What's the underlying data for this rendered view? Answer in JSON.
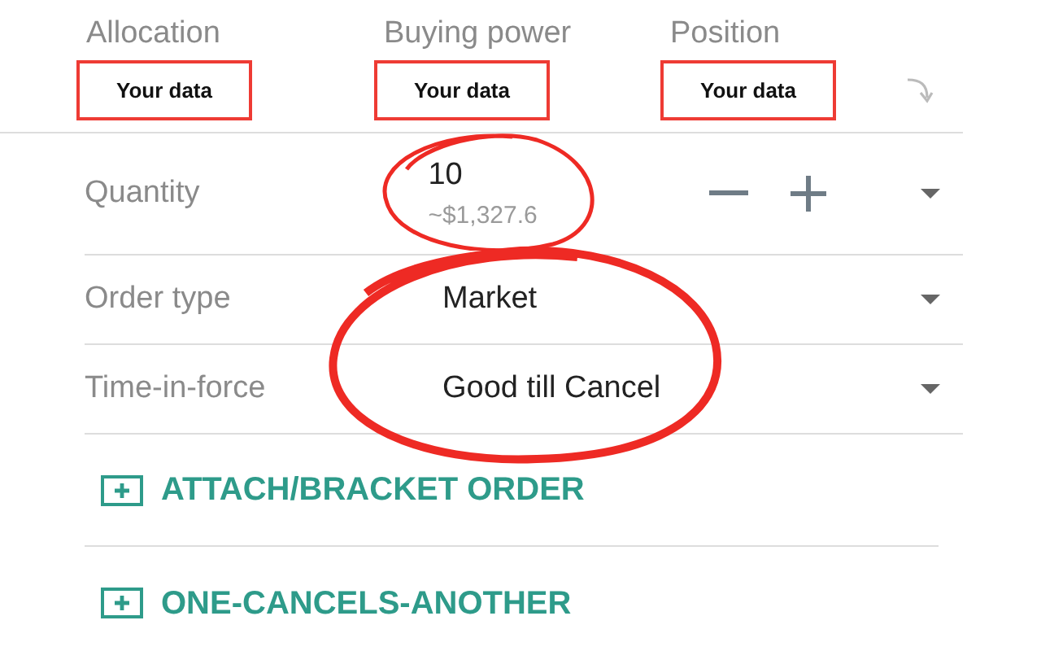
{
  "summary": [
    {
      "label": "Allocation",
      "value": "Your data",
      "highlighted": true
    },
    {
      "label": "Buying power",
      "value": "Your data",
      "highlighted": true
    },
    {
      "label": "Position",
      "value": "Your data",
      "highlighted": true
    }
  ],
  "rows": [
    {
      "kind": "stepper",
      "label": "Quantity",
      "value": "10",
      "note": "~$1,327.6"
    },
    {
      "kind": "select",
      "label": "Order type",
      "value": "Market"
    },
    {
      "kind": "select",
      "label": "Time-in-force",
      "value": "Good till Cancel"
    }
  ],
  "links": [
    "ATTACH/BRACKET ORDER",
    "ONE-CANCELS-ANOTHER"
  ]
}
